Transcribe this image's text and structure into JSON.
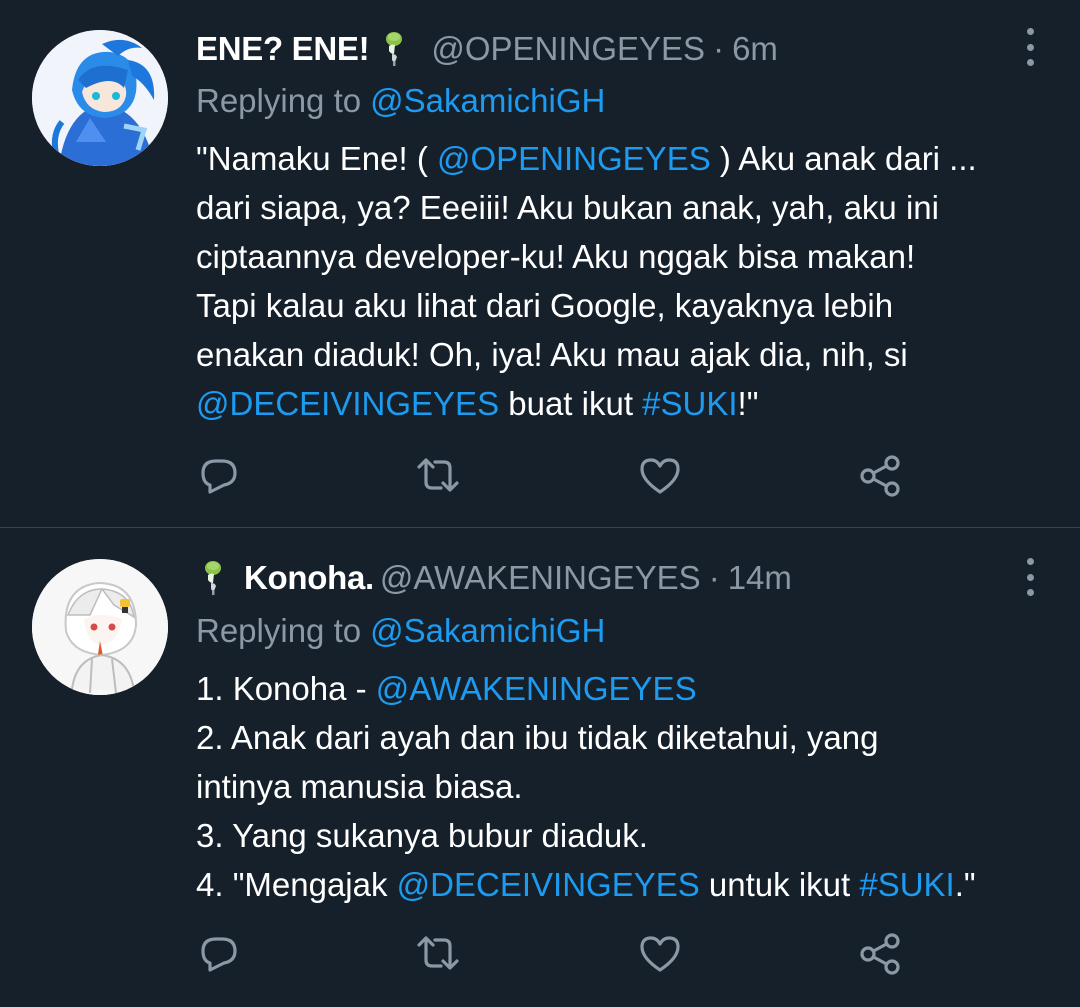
{
  "tweets": [
    {
      "display_name": "ENE? ENE!",
      "handle": "@OPENINGEYES",
      "separator": "·",
      "time": "6m",
      "replying_label": "Replying to",
      "replying_to": "@SakamichiGH",
      "body_lines": [
        [
          {
            "t": "text",
            "v": "\"Namaku Ene! ( "
          },
          {
            "t": "mention",
            "v": "@OPENINGEYES"
          },
          {
            "t": "text",
            "v": " ) Aku anak dari ..."
          }
        ],
        [
          {
            "t": "text",
            "v": "dari siapa, ya? Eeeiii! Aku bukan anak, yah, aku ini"
          }
        ],
        [
          {
            "t": "text",
            "v": "ciptaannya developer-ku! Aku nggak bisa makan!"
          }
        ],
        [
          {
            "t": "text",
            "v": "Tapi kalau aku lihat dari Google, kayaknya lebih"
          }
        ],
        [
          {
            "t": "text",
            "v": "enakan diaduk! Oh, iya! Aku mau ajak dia, nih, si"
          }
        ],
        [
          {
            "t": "mention",
            "v": "@DECEIVINGEYES"
          },
          {
            "t": "text",
            "v": " buat ikut "
          },
          {
            "t": "hashtag",
            "v": "#SUKI"
          },
          {
            "t": "text",
            "v": "!\""
          }
        ]
      ]
    },
    {
      "display_name": "Konoha.",
      "handle": "@AWAKENINGEYES",
      "separator": "·",
      "time": "14m",
      "replying_label": "Replying to",
      "replying_to": "@SakamichiGH",
      "body_lines": [
        [
          {
            "t": "text",
            "v": "1. Konoha - "
          },
          {
            "t": "mention",
            "v": "@AWAKENINGEYES"
          }
        ],
        [
          {
            "t": "text",
            "v": "2. Anak dari ayah dan ibu tidak diketahui, yang"
          }
        ],
        [
          {
            "t": "text",
            "v": "intinya manusia biasa."
          }
        ],
        [
          {
            "t": "text",
            "v": "3. Yang sukanya bubur diaduk."
          }
        ],
        [
          {
            "t": "text",
            "v": "4. \"Mengajak  "
          },
          {
            "t": "mention",
            "v": "@DECEIVINGEYES"
          },
          {
            "t": "text",
            "v": " untuk ikut "
          },
          {
            "t": "hashtag",
            "v": "#SUKI"
          },
          {
            "t": "text",
            "v": ".\""
          }
        ]
      ]
    }
  ],
  "icons": {
    "name_emoji": "skewer-emoji",
    "more": "more-vertical-icon",
    "reply": "reply-icon",
    "retweet": "retweet-icon",
    "like": "heart-icon",
    "share": "share-icon"
  },
  "colors": {
    "background": "#15202b",
    "text": "#ffffff",
    "secondary": "#8b98a5",
    "link": "#1d9bf0",
    "divider": "#38444d"
  }
}
